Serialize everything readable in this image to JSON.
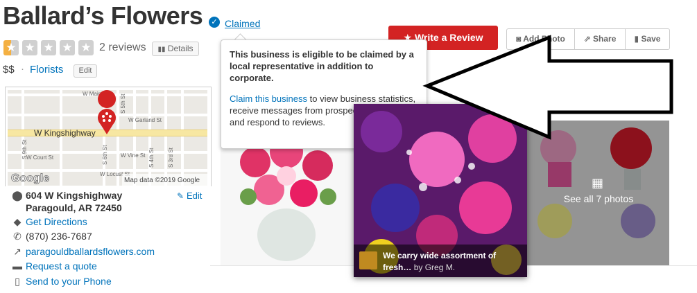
{
  "business": {
    "name": "Ballard’s Flowers",
    "claimed_label": "Claimed",
    "verified_icon": "check-circle-icon",
    "rating_stars": 0.5,
    "rating_max": 5,
    "reviews_count_label": "2 reviews",
    "details_label": "Details",
    "price": "$$",
    "separator": "·",
    "category": "Florists",
    "edit_label": "Edit"
  },
  "actions": {
    "write_review": "Write a Review",
    "add_photo": "Add Photo",
    "share": "Share",
    "save": "Save"
  },
  "popover": {
    "heading": "This business is eligible to be claimed by a local representative in addition to corporate.",
    "link": "Claim this business",
    "body": " to view business statistics, receive messages from prospective customers, and respond to reviews."
  },
  "map": {
    "streets": [
      "W Main St",
      "W Garland St",
      "W Kingshighway",
      "W Vine St",
      "W Court St",
      "W Locust St",
      "S 9th St",
      "S 6th St",
      "S 5th St",
      "S 4th St",
      "S 3rd St"
    ],
    "attribution": "Map data ©2019 Google",
    "logo": "Google"
  },
  "info": {
    "address_line1": "604 W Kingshighway",
    "address_line2": "Paragould, AR 72450",
    "edit_label": "Edit",
    "directions": "Get Directions",
    "phone": "(870) 236-7687",
    "website": "paragouldballardsflowers.com",
    "quote": "Request a quote",
    "send_phone": "Send to your Phone"
  },
  "photos": {
    "caption": "We carry wide assortment of fresh…",
    "caption_by": "by Greg M.",
    "see_all": "See all 7 photos"
  },
  "colors": {
    "brand_red": "#d32323",
    "link_blue": "#0073bb",
    "star_orange": "#f4b042"
  }
}
